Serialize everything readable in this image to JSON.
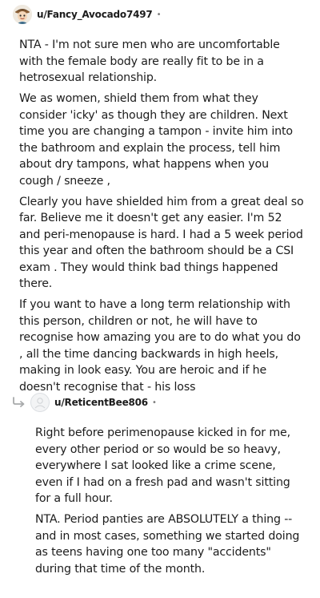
{
  "comment": {
    "username": "u/Fancy_Avocado7497",
    "separator": "•",
    "paragraphs": [
      "NTA - I'm not sure men who are uncomfortable with the female body are really fit to be in a hetrosexual relationship.",
      "We as women, shield them from what they consider 'icky' as though they are children. Next time you are changing a tampon - invite him into the bathroom and explain the process, tell him about dry tampons, what happens when you cough / sneeze ,",
      "Clearly you have shielded him from a great deal so far. Believe me it doesn't get any easier. I'm 52 and peri-menopause is hard. I had a 5 week period this year and often the bathroom should be a CSI exam . They would think bad things happened there.",
      "If you want to have a long term relationship with this person, children or not, he will have to recognise how amazing you are to do what you do , all the time dancing backwards in high heels, making in look easy. You are heroic and if he doesn't recognise that - his loss"
    ]
  },
  "reply": {
    "username": "u/ReticentBee806",
    "separator": "•",
    "paragraphs": [
      "Right before perimenopause kicked in for me, every other period or so would be so heavy, everywhere I sat looked like a crime scene, even if I had on a fresh pad and wasn't sitting for a full hour.",
      "NTA. Period panties are ABSOLUTELY a thing -- and in most cases, something we started doing as teens having one too many \"accidents\" during that time of the month."
    ]
  },
  "colors": {
    "text": "#1c1c1c",
    "meta": "#7c7c7c",
    "reply_arrow": "#a8aaab"
  },
  "icons": {
    "avatar_top": "avatar-illustration-icon",
    "reply_arrow": "reply-arrow-icon",
    "avatar_reply": "default-avatar-icon"
  }
}
